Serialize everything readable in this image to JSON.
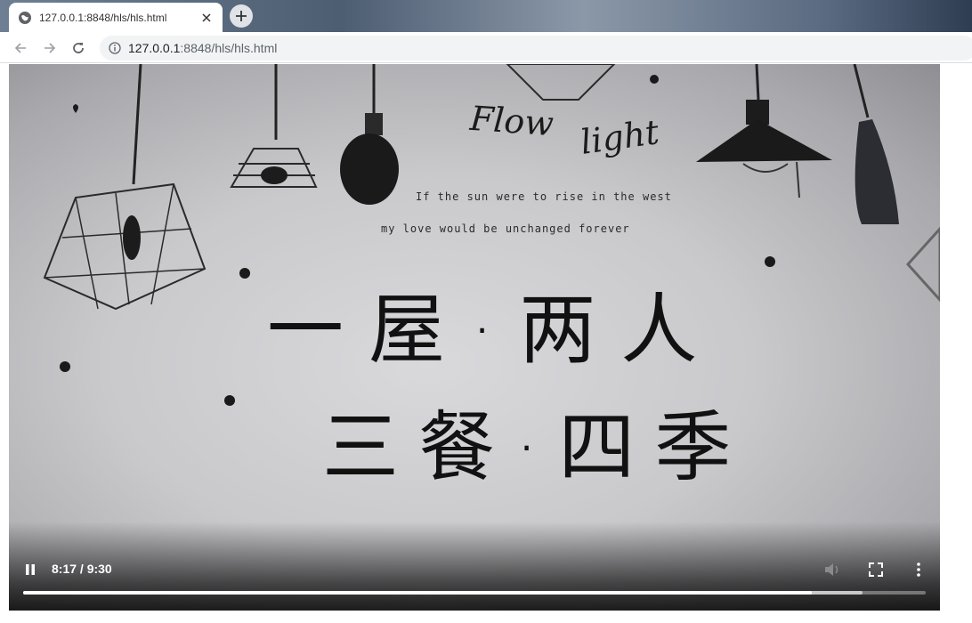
{
  "tab": {
    "title": "127.0.0.1:8848/hls/hls.html",
    "favicon": "globe-icon"
  },
  "toolbar": {
    "url_host": "127.0.0.1",
    "url_rest": ":8848/hls/hls.html"
  },
  "video": {
    "wall_text": {
      "flow": "Flow",
      "light": "light",
      "line1": "If the sun were to rise in the west",
      "line2": "my love would be unchanged forever",
      "cn1": "一屋·两人",
      "cn2": "三餐·四季"
    },
    "controls": {
      "time": "8:17 / 9:30",
      "played_fraction": 0.8737,
      "buffered_fraction": 0.93
    }
  },
  "colors": {
    "accent": "#ffffff",
    "chrome_bg": "#f1f3f4"
  }
}
